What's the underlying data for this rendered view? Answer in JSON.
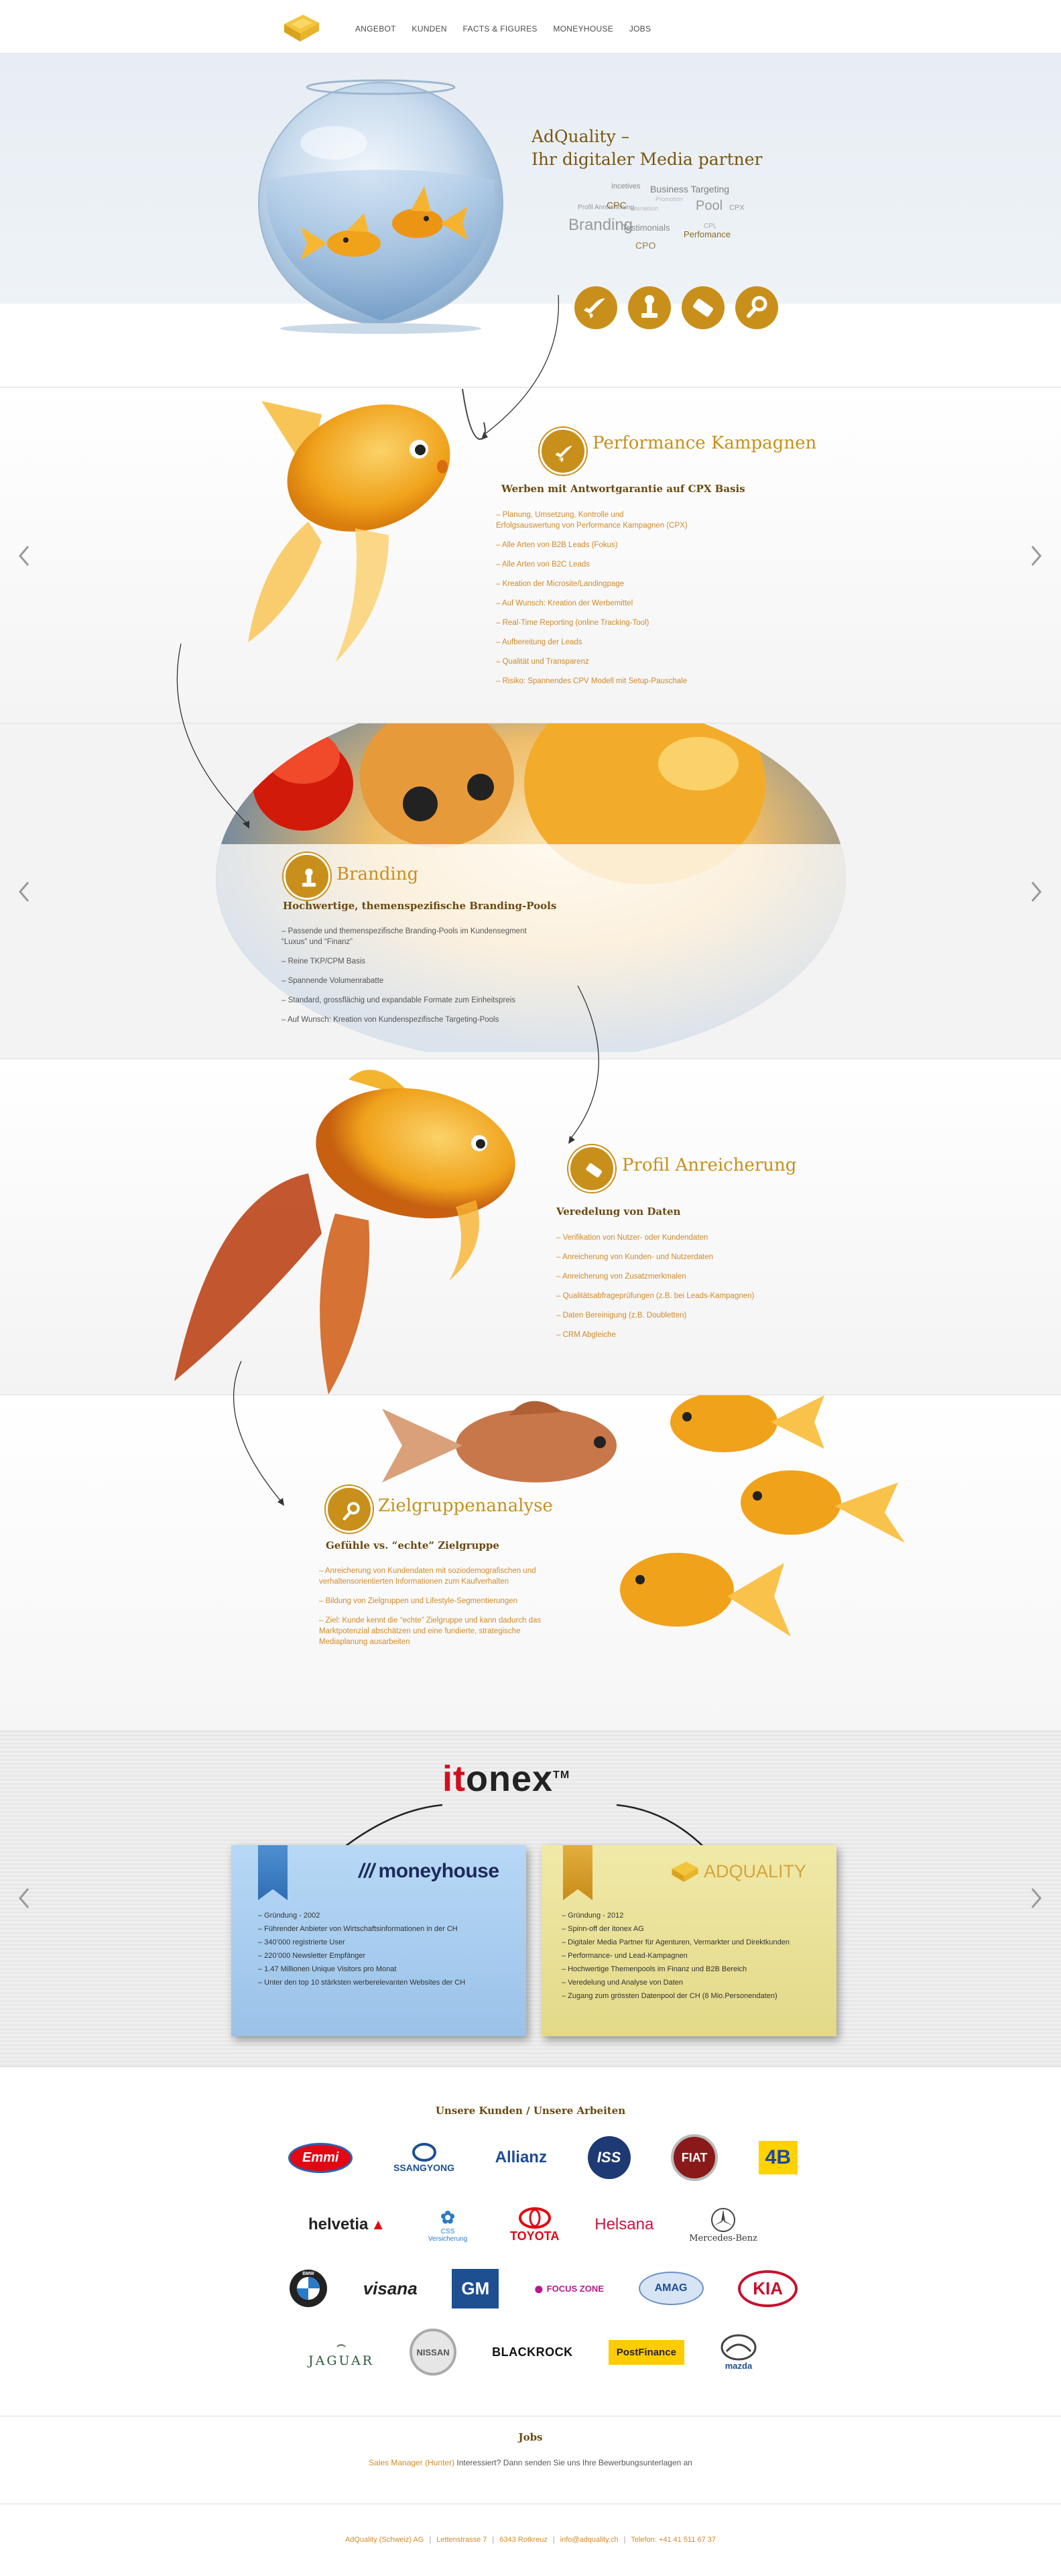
{
  "nav": {
    "items": [
      "ANGEBOT",
      "KUNDEN",
      "FACTS & FIGURES",
      "MONEYHOUSE",
      "JOBS"
    ]
  },
  "colors": {
    "gold": "#c8901a",
    "dark_gold": "#6a4a12",
    "orange_text": "#d08a2a",
    "red": "#d20e1e",
    "blue_note": "#a9cdf0",
    "yellow_note": "#ece39a"
  },
  "hero": {
    "title_line1": "AdQuality –",
    "title_line2": "Ihr digitaler Media partner",
    "tags": [
      {
        "t": "Incetives",
        "fs": 11
      },
      {
        "t": "Business Targeting",
        "fs": 14
      },
      {
        "t": "Promotion",
        "fs": 9
      },
      {
        "t": "Profil Anreicherung",
        "fs": 10
      },
      {
        "t": "CPC",
        "fs": 14
      },
      {
        "t": "Interaktion",
        "fs": 9
      },
      {
        "t": "Pool",
        "fs": 20
      },
      {
        "t": "CPX",
        "fs": 11
      },
      {
        "t": "Branding",
        "fs": 24
      },
      {
        "t": "CPL",
        "fs": 10
      },
      {
        "t": "Testimonials",
        "fs": 13
      },
      {
        "t": "Perfomance",
        "fs": 13
      },
      {
        "t": "CPO",
        "fs": 14
      }
    ],
    "icons": [
      "rocket-icon",
      "stamp-icon",
      "eraser-icon",
      "magnifier-icon"
    ]
  },
  "performance": {
    "title": "Performance Kampagnen",
    "subtitle": "Werben mit Antwortgarantie auf CPX Basis",
    "bullets": [
      "– Planung, Umsetzung, Kontrolle und\nErfolgsauswertung von Performance Kampagnen (CPX)",
      "– Alle Arten von B2B Leads (Fokus)",
      "– Alle Arten von B2C Leads",
      "– Kreation der Microsite/Landingpage",
      "– Auf Wunsch: Kreation der Werbemittel",
      "– Real-Time Reporting (online Tracking-Tool)",
      "– Aufbereitung der Leads",
      "– Qualität und Transparenz",
      "– Risiko: Spannendes CPV Modell mit Setup-Pauschale"
    ]
  },
  "branding": {
    "title": "Branding",
    "subtitle": "Hochwertige, themenspezifische Branding-Pools",
    "bullets": [
      "– Passende und themenspezifische Branding-Pools im Kundensegment\n“Luxus” und “Finanz”",
      "– Reine TKP/CPM Basis",
      "– Spannende Volumenrabatte",
      "– Standard, grossflächig und expandable Formate zum Einheitspreis",
      "– Auf Wunsch: Kreation von Kundenspezifische Targeting-Pools"
    ]
  },
  "profil": {
    "title": "Profil Anreicherung",
    "subtitle": "Veredelung von Daten",
    "bullets": [
      "– Verifikation von Nutzer- oder Kundendaten",
      "– Anreicherung von Kunden- und Nutzerdaten",
      "– Anreicherung von Zusatzmerkmalen",
      "– Qualitätsabfrageprüfungen (z.B. bei Leads-Kampagnen)",
      "– Daten Bereinigung (z.B. Doubletten)",
      "– CRM Abgleiche"
    ]
  },
  "ziel": {
    "title": "Zielgruppenanalyse",
    "subtitle": "Gefühle vs. “echte” Zielgruppe",
    "bullets": [
      "– Anreicherung von Kundendaten mit soziodemografischen und\nverhaltensorientierten Informationen zum Kaufverhalten",
      "– Bildung von Zielgruppen und Lifestyle-Segmentierungen",
      "– Ziel: Kunde kennt die “echte” Zielgruppe und kann dadurch das\nMarktpotenzial abschätzen und eine fundierte, strategische\nMediaplanung ausarbeiten"
    ]
  },
  "itonex": {
    "logo_it": "it",
    "logo_onex": "onex",
    "logo_tm": "TM",
    "moneyhouse": {
      "name": "moneyhouse",
      "bullets": [
        "– Gründung - 2002",
        "– Führender Anbieter von Wirtschaftsinformationen in der CH",
        "– 340’000 registrierte User",
        "– 220’000 Newsletter Empfänger",
        "– 1.47 Millionen Unique Visitors pro Monat",
        "– Unter den top 10 stärksten werberelevanten Websites der CH"
      ]
    },
    "adquality": {
      "name": "ADQUALITY",
      "bullets": [
        "– Gründung - 2012",
        "– Spinn-off der itonex AG",
        "– Digitaler Media Partner für Agenturen, Vermarkter und Direktkunden",
        "– Performance- und Lead-Kampagnen",
        "– Hochwertige Themenpools im Finanz und B2B Bereich",
        "– Veredelung und Analyse von Daten",
        "– Zugang zum grössten Datenpool der CH (8 Mio.Personendaten)"
      ]
    }
  },
  "clients": {
    "title": "Unsere Kunden / Unsere Arbeiten",
    "rows": [
      [
        "Emmi",
        "SSANGYONG",
        "Allianz",
        "ISS",
        "FIAT",
        "4B"
      ],
      [
        "helvetia",
        "CSS Versicherung",
        "TOYOTA",
        "Helsana",
        "Mercedes-Benz"
      ],
      [
        "BMW",
        "visana",
        "GM",
        "FOCUS ZONE",
        "AMAG",
        "KIA"
      ],
      [
        "JAGUAR",
        "NISSAN",
        "BLACKROCK",
        "PostFinance",
        "mazda"
      ]
    ]
  },
  "jobs": {
    "title": "Jobs",
    "link": "Sales Manager (Hunter)",
    "text": " Interessiert? Dann senden Sie uns Ihre Bewerbungsunterlagen an"
  },
  "footer": {
    "company": "AdQuality (Schweiz) AG",
    "street": "Lettenstrasse 7",
    "city": "6343 Rotkreuz",
    "email": "info@adquality.ch",
    "phone": "Telefon: +41 41 511 67 37"
  }
}
